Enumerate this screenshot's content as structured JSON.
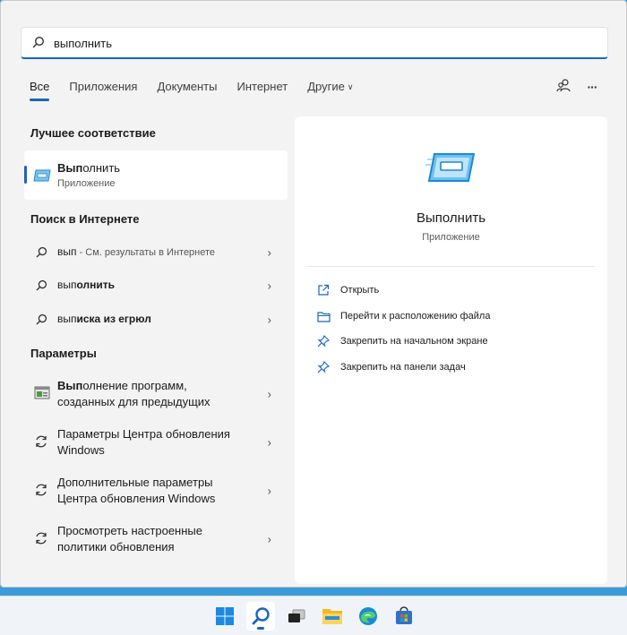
{
  "search": {
    "query": "выполнить",
    "icon": "search-icon"
  },
  "tabs": [
    {
      "label": "Все"
    },
    {
      "label": "Приложения"
    },
    {
      "label": "Документы"
    },
    {
      "label": "Интернет"
    },
    {
      "label": "Другие"
    }
  ],
  "toolbar": {
    "share_icon": "people-icon",
    "more_icon": "ellipsis-icon",
    "more_glyph": "···"
  },
  "best_match": {
    "heading": "Лучшее соответствие",
    "name_bold": "Вып",
    "name_rest": "олнить",
    "type": "Приложение"
  },
  "web": {
    "heading": "Поиск в Интернете",
    "items": [
      {
        "bold": "",
        "text": "вып",
        "suffix": " - См. результаты в Интернете"
      },
      {
        "plain": "вып",
        "bold": "олнить"
      },
      {
        "plain": "вып",
        "bold": "иска из егрюл"
      }
    ]
  },
  "settings": {
    "heading": "Параметры",
    "items": [
      {
        "bold": "Вып",
        "line1_rest": "олнение программ,",
        "line2": "созданных для предыдущих"
      },
      {
        "line1": "Параметры Центра обновления",
        "line2": "Windows"
      },
      {
        "line1": "Дополнительные параметры",
        "line2": "Центра обновления Windows"
      },
      {
        "line1": "Просмотреть настроенные",
        "line2": "политики обновления"
      }
    ]
  },
  "detail": {
    "title": "Выполнить",
    "subtitle": "Приложение",
    "actions": [
      {
        "label": "Открыть",
        "icon": "open-external-icon"
      },
      {
        "label": "Перейти к расположению файла",
        "icon": "folder-icon"
      },
      {
        "label": "Закрепить на начальном экране",
        "icon": "pin-icon"
      },
      {
        "label": "Закрепить на панели задач",
        "icon": "pin-icon"
      }
    ]
  },
  "taskbar": {
    "icons": [
      "windows-start-icon",
      "search-icon",
      "task-view-icon",
      "file-explorer-icon",
      "edge-browser-icon",
      "store-icon"
    ]
  },
  "colors": {
    "accent": "#1a64c0",
    "taskbar_bg": "#f0f4f8",
    "panel_bg": "#f3f3f3"
  }
}
